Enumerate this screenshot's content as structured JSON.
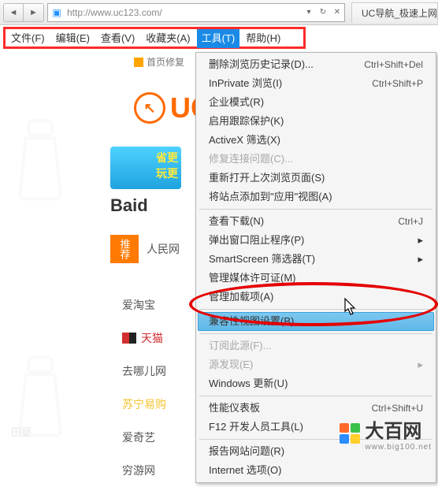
{
  "toolbar": {
    "url": "http://www.uc123.com/",
    "tab_title": "UC导航_极速上网"
  },
  "menubar": {
    "file": "文件(F)",
    "edit": "编辑(E)",
    "view": "查看(V)",
    "favorites": "收藏夹(A)",
    "tools": "工具(T)",
    "help": "帮助(H)"
  },
  "breadcrumb": {
    "home": "首页修复"
  },
  "logo_text": "UC",
  "banner": {
    "line1": "省更",
    "line2": "玩更"
  },
  "baidu_text": "Baid",
  "tabs": {
    "recommend": "推荐",
    "renmin": "人民网"
  },
  "sidebar": {
    "aitaobao": "爱淘宝",
    "tmall": "天猫",
    "qunar": "去哪儿网",
    "suning": "苏宁易购",
    "aiqiyi": "爱奇艺",
    "qiongyou": "穷游网"
  },
  "tools_menu": [
    {
      "label": "删除浏览历史记录(D)...",
      "shortcut": "Ctrl+Shift+Del"
    },
    {
      "label": "InPrivate 浏览(I)",
      "shortcut": "Ctrl+Shift+P"
    },
    {
      "label": "企业模式(R)"
    },
    {
      "label": "启用跟踪保护(K)"
    },
    {
      "label": "ActiveX 筛选(X)"
    },
    {
      "label": "修复连接问题(C)...",
      "disabled": true
    },
    {
      "label": "重新打开上次浏览页面(S)"
    },
    {
      "label": "将站点添加到\"应用\"视图(A)"
    },
    {
      "sep": true
    },
    {
      "label": "查看下载(N)",
      "shortcut": "Ctrl+J"
    },
    {
      "label": "弹出窗口阻止程序(P)",
      "sub": true
    },
    {
      "label": "SmartScreen 筛选器(T)",
      "sub": true
    },
    {
      "label": "管理媒体许可证(M)"
    },
    {
      "label": "管理加载项(A)"
    },
    {
      "sep": true
    },
    {
      "label": "兼容性视图设置(B)",
      "highlight": true
    },
    {
      "sep": true
    },
    {
      "label": "订阅此源(F)...",
      "disabled": true
    },
    {
      "label": "源发现(E)",
      "disabled": true,
      "sub": true
    },
    {
      "label": "Windows 更新(U)"
    },
    {
      "sep": true
    },
    {
      "label": "性能仪表板",
      "shortcut": "Ctrl+Shift+U"
    },
    {
      "label": "F12 开发人员工具(L)"
    },
    {
      "sep": true
    },
    {
      "label": "报告网站问题(R)"
    },
    {
      "label": "Internet 选项(O)"
    }
  ],
  "dabaiwang": {
    "text": "大百网",
    "sub": "www.big100.net"
  },
  "ghost_tag": "田婴"
}
